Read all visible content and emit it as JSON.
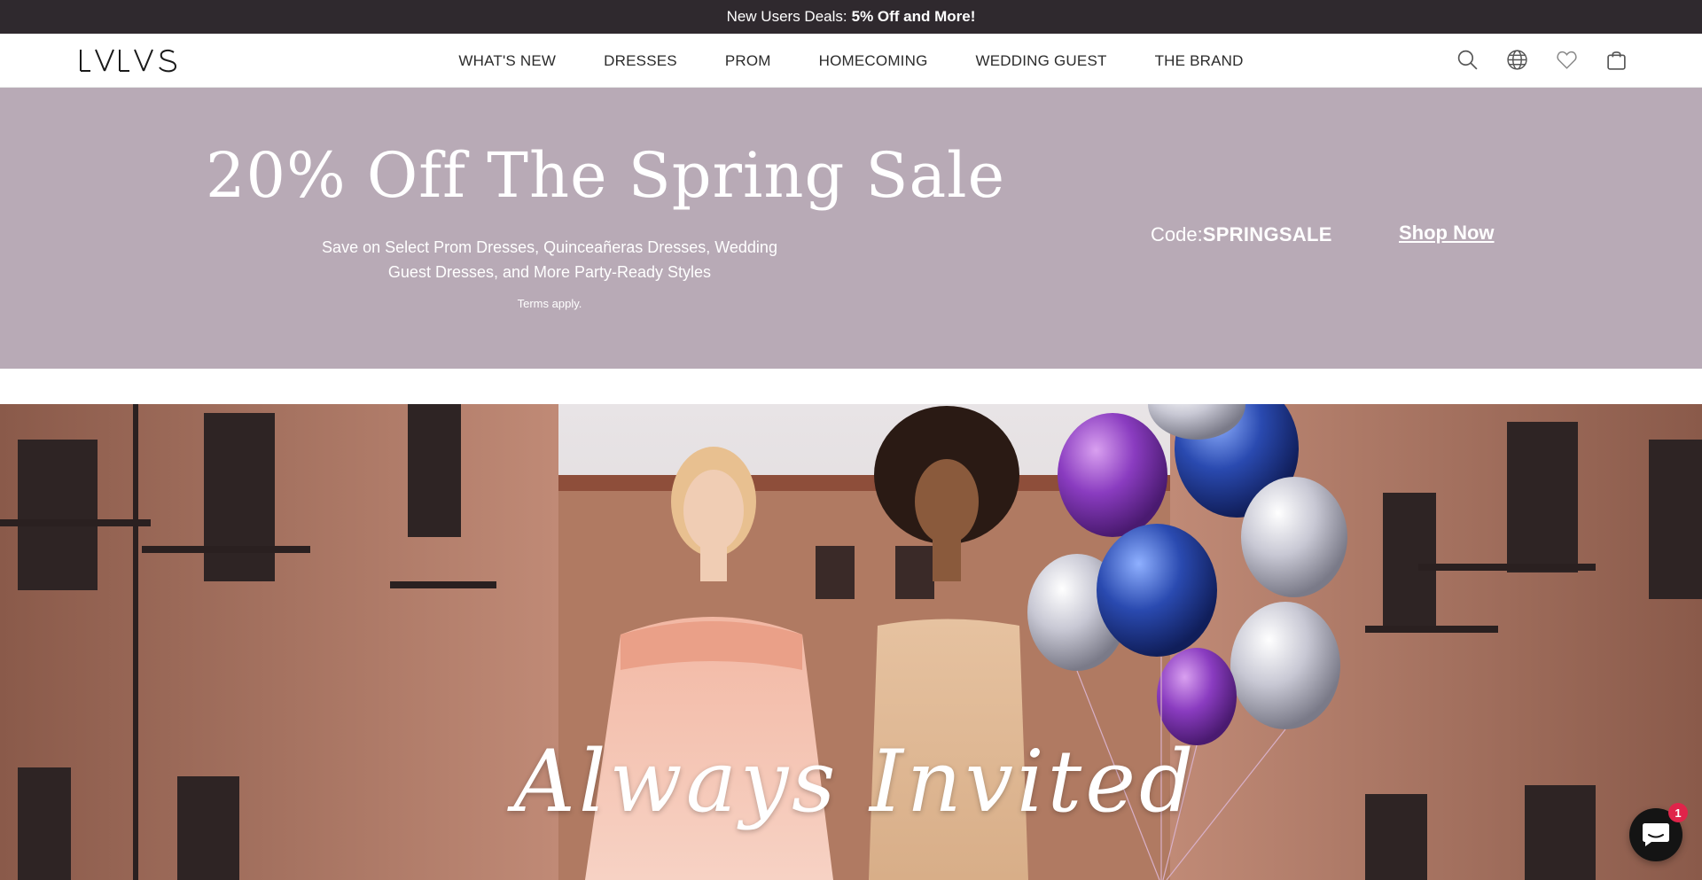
{
  "announcement": {
    "prefix": "New Users Deals:",
    "highlight": "5% Off and More!"
  },
  "header": {
    "logo_text": "LVLVS",
    "nav": [
      {
        "label": "WHAT'S NEW"
      },
      {
        "label": "DRESSES"
      },
      {
        "label": "PROM"
      },
      {
        "label": "HOMECOMING"
      },
      {
        "label": "WEDDING GUEST"
      },
      {
        "label": "THE BRAND"
      }
    ],
    "icons": [
      "search-icon",
      "globe-icon",
      "heart-icon",
      "bag-icon"
    ]
  },
  "promo": {
    "title": "20% Off The Spring Sale",
    "subtitle": "Save on Select Prom Dresses, Quinceañeras Dresses, Wedding Guest Dresses, and More Party-Ready Styles",
    "terms": "Terms apply.",
    "code_label": "Code:",
    "code_value": "SPRINGSALE",
    "cta": "Shop Now",
    "background": "#b8aab6"
  },
  "hero": {
    "script_text": "Always Invited"
  },
  "chat": {
    "badge_count": "1"
  },
  "colors": {
    "announcement_bg": "#2f292e",
    "promo_bg": "#b8aab6",
    "chat_bg": "#141414",
    "badge": "#e0244a"
  }
}
